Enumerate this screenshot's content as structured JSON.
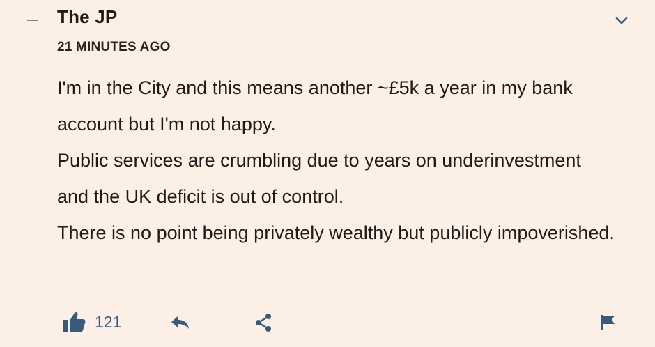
{
  "comment": {
    "author": "The JP",
    "timestamp": "21 MINUTES AGO",
    "paragraphs": [
      "I'm in the City and this means another ~£5k a year in my bank account but I'm not happy.",
      "Public services are crumbling due to years on underinvestment and the UK deficit is out of control.",
      "There is no point being privately wealthy but publicly impoverished."
    ]
  },
  "actions": {
    "like_count": "121"
  },
  "icons": {
    "collapse": "minus-icon",
    "expand": "chevron-down-icon",
    "like": "thumbs-up-icon",
    "reply": "reply-arrow-icon",
    "share": "share-icon",
    "report": "flag-icon"
  },
  "colors": {
    "background": "#fcefe6",
    "text": "#1f1b18",
    "accent": "#355c7d",
    "muted": "#8a8380"
  }
}
